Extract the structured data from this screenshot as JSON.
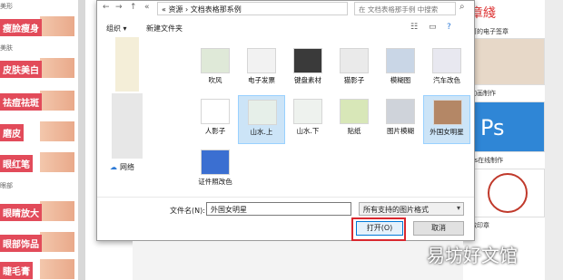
{
  "left_panel": {
    "items": [
      {
        "label": "瘦脸瘦身"
      },
      {
        "label": "皮肤美白"
      },
      {
        "label": "祛痘祛斑"
      },
      {
        "label": "磨皮"
      },
      {
        "label": "眼红笔"
      },
      {
        "label": "眼睛放大"
      },
      {
        "label": "眼部饰品"
      },
      {
        "label": "睫毛膏"
      }
    ],
    "sections": [
      "美形",
      "美肤",
      "眼部"
    ]
  },
  "right_panel": {
    "labels": [
      "章綫",
      "可的电子签章",
      "动画制作",
      "ps在线制作",
      "做印章"
    ]
  },
  "dialog": {
    "nav": {
      "back": "←",
      "forward": "→",
      "up": "↑",
      "chevron": "«"
    },
    "address": {
      "text": "« 资源 › 文档表格那系例"
    },
    "search": {
      "placeholder": "在 文档表格那手例 中搜索"
    },
    "toolbar": {
      "organize": "组织 ▾",
      "new_folder": "新建文件夹",
      "view_icon": "view-icon",
      "help_icon": "help-icon"
    },
    "nav_pane": {
      "network": "网络"
    },
    "files": [
      {
        "name": "吹风",
        "selected": false,
        "color": "#dfe9d8"
      },
      {
        "name": "电子发票",
        "selected": false,
        "color": "#f2f2f2"
      },
      {
        "name": "键盘素材",
        "selected": false,
        "color": "#3a3a3a"
      },
      {
        "name": "猫影子",
        "selected": false,
        "color": "#eaeaea"
      },
      {
        "name": "模糊图",
        "selected": false,
        "color": "#c9d6e6"
      },
      {
        "name": "汽车改色",
        "selected": false,
        "color": "#e8e8f0"
      },
      {
        "name": "人影子",
        "selected": false,
        "color": "#ffffff"
      },
      {
        "name": "山水.上",
        "selected": true,
        "color": "#e6efe9"
      },
      {
        "name": "山水.下",
        "selected": false,
        "color": "#eef2ee"
      },
      {
        "name": "贴纸",
        "selected": false,
        "color": "#d8e7b8"
      },
      {
        "name": "图片模糊",
        "selected": false,
        "color": "#cfd3da"
      },
      {
        "name": "外国女明星",
        "selected": true,
        "color": "#b48766"
      },
      {
        "name": "证件照改色",
        "selected": false,
        "color": "#3b6fd1"
      }
    ],
    "filename_label": "文件名(N):",
    "filename_value": "外国女明星",
    "filetype_value": "所有支持的图片格式",
    "open_label": "打开(O)",
    "cancel_label": "取消"
  },
  "watermark": "易坊好文馆"
}
